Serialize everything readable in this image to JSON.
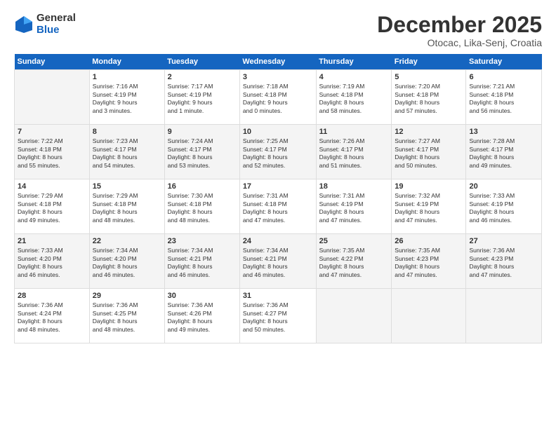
{
  "logo": {
    "general": "General",
    "blue": "Blue"
  },
  "title": "December 2025",
  "subtitle": "Otocac, Lika-Senj, Croatia",
  "weekdays": [
    "Sunday",
    "Monday",
    "Tuesday",
    "Wednesday",
    "Thursday",
    "Friday",
    "Saturday"
  ],
  "weeks": [
    [
      {
        "day": "",
        "info": ""
      },
      {
        "day": "1",
        "info": "Sunrise: 7:16 AM\nSunset: 4:19 PM\nDaylight: 9 hours\nand 3 minutes."
      },
      {
        "day": "2",
        "info": "Sunrise: 7:17 AM\nSunset: 4:19 PM\nDaylight: 9 hours\nand 1 minute."
      },
      {
        "day": "3",
        "info": "Sunrise: 7:18 AM\nSunset: 4:18 PM\nDaylight: 9 hours\nand 0 minutes."
      },
      {
        "day": "4",
        "info": "Sunrise: 7:19 AM\nSunset: 4:18 PM\nDaylight: 8 hours\nand 58 minutes."
      },
      {
        "day": "5",
        "info": "Sunrise: 7:20 AM\nSunset: 4:18 PM\nDaylight: 8 hours\nand 57 minutes."
      },
      {
        "day": "6",
        "info": "Sunrise: 7:21 AM\nSunset: 4:18 PM\nDaylight: 8 hours\nand 56 minutes."
      }
    ],
    [
      {
        "day": "7",
        "info": "Sunrise: 7:22 AM\nSunset: 4:18 PM\nDaylight: 8 hours\nand 55 minutes."
      },
      {
        "day": "8",
        "info": "Sunrise: 7:23 AM\nSunset: 4:17 PM\nDaylight: 8 hours\nand 54 minutes."
      },
      {
        "day": "9",
        "info": "Sunrise: 7:24 AM\nSunset: 4:17 PM\nDaylight: 8 hours\nand 53 minutes."
      },
      {
        "day": "10",
        "info": "Sunrise: 7:25 AM\nSunset: 4:17 PM\nDaylight: 8 hours\nand 52 minutes."
      },
      {
        "day": "11",
        "info": "Sunrise: 7:26 AM\nSunset: 4:17 PM\nDaylight: 8 hours\nand 51 minutes."
      },
      {
        "day": "12",
        "info": "Sunrise: 7:27 AM\nSunset: 4:17 PM\nDaylight: 8 hours\nand 50 minutes."
      },
      {
        "day": "13",
        "info": "Sunrise: 7:28 AM\nSunset: 4:17 PM\nDaylight: 8 hours\nand 49 minutes."
      }
    ],
    [
      {
        "day": "14",
        "info": "Sunrise: 7:29 AM\nSunset: 4:18 PM\nDaylight: 8 hours\nand 49 minutes."
      },
      {
        "day": "15",
        "info": "Sunrise: 7:29 AM\nSunset: 4:18 PM\nDaylight: 8 hours\nand 48 minutes."
      },
      {
        "day": "16",
        "info": "Sunrise: 7:30 AM\nSunset: 4:18 PM\nDaylight: 8 hours\nand 48 minutes."
      },
      {
        "day": "17",
        "info": "Sunrise: 7:31 AM\nSunset: 4:18 PM\nDaylight: 8 hours\nand 47 minutes."
      },
      {
        "day": "18",
        "info": "Sunrise: 7:31 AM\nSunset: 4:19 PM\nDaylight: 8 hours\nand 47 minutes."
      },
      {
        "day": "19",
        "info": "Sunrise: 7:32 AM\nSunset: 4:19 PM\nDaylight: 8 hours\nand 47 minutes."
      },
      {
        "day": "20",
        "info": "Sunrise: 7:33 AM\nSunset: 4:19 PM\nDaylight: 8 hours\nand 46 minutes."
      }
    ],
    [
      {
        "day": "21",
        "info": "Sunrise: 7:33 AM\nSunset: 4:20 PM\nDaylight: 8 hours\nand 46 minutes."
      },
      {
        "day": "22",
        "info": "Sunrise: 7:34 AM\nSunset: 4:20 PM\nDaylight: 8 hours\nand 46 minutes."
      },
      {
        "day": "23",
        "info": "Sunrise: 7:34 AM\nSunset: 4:21 PM\nDaylight: 8 hours\nand 46 minutes."
      },
      {
        "day": "24",
        "info": "Sunrise: 7:34 AM\nSunset: 4:21 PM\nDaylight: 8 hours\nand 46 minutes."
      },
      {
        "day": "25",
        "info": "Sunrise: 7:35 AM\nSunset: 4:22 PM\nDaylight: 8 hours\nand 47 minutes."
      },
      {
        "day": "26",
        "info": "Sunrise: 7:35 AM\nSunset: 4:23 PM\nDaylight: 8 hours\nand 47 minutes."
      },
      {
        "day": "27",
        "info": "Sunrise: 7:36 AM\nSunset: 4:23 PM\nDaylight: 8 hours\nand 47 minutes."
      }
    ],
    [
      {
        "day": "28",
        "info": "Sunrise: 7:36 AM\nSunset: 4:24 PM\nDaylight: 8 hours\nand 48 minutes."
      },
      {
        "day": "29",
        "info": "Sunrise: 7:36 AM\nSunset: 4:25 PM\nDaylight: 8 hours\nand 48 minutes."
      },
      {
        "day": "30",
        "info": "Sunrise: 7:36 AM\nSunset: 4:26 PM\nDaylight: 8 hours\nand 49 minutes."
      },
      {
        "day": "31",
        "info": "Sunrise: 7:36 AM\nSunset: 4:27 PM\nDaylight: 8 hours\nand 50 minutes."
      },
      {
        "day": "",
        "info": ""
      },
      {
        "day": "",
        "info": ""
      },
      {
        "day": "",
        "info": ""
      }
    ]
  ]
}
